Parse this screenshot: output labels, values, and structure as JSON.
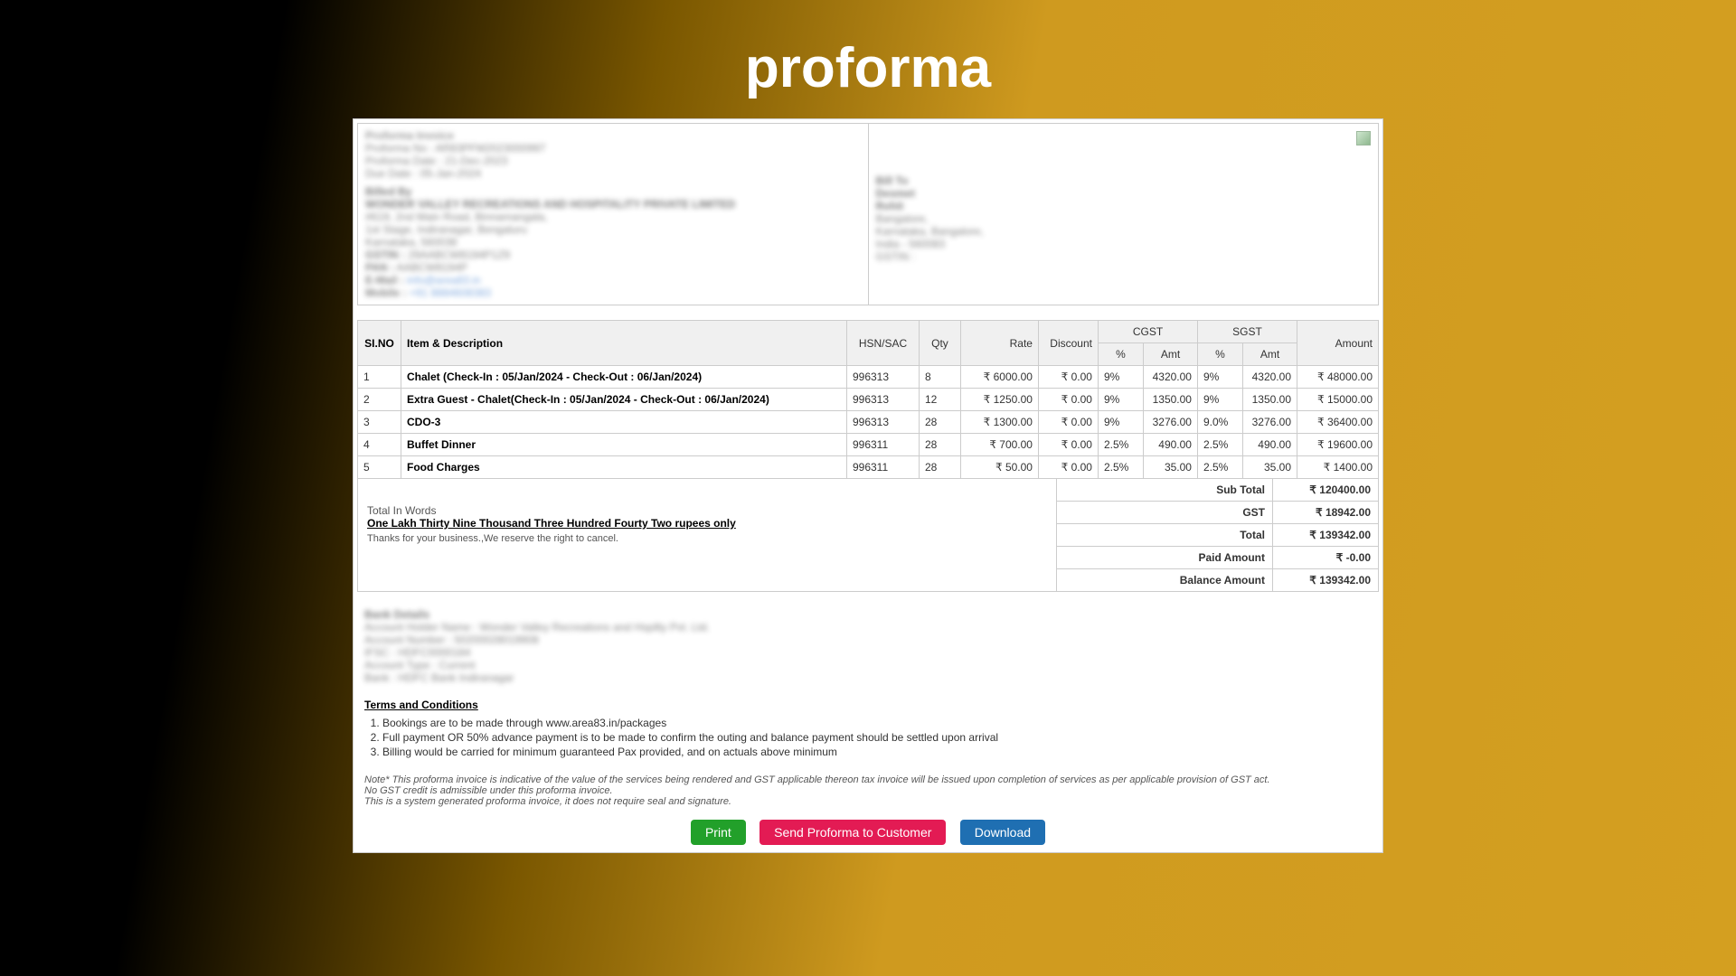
{
  "page_title": "proforma",
  "header": {
    "title": "Proforma Invoice",
    "proforma_no_label": "Proforma No :",
    "proforma_no": "AR83PFM2023000997",
    "proforma_date_label": "Proforma Date :",
    "proforma_date": "21-Dec-2023",
    "due_date_label": "Due Date :",
    "due_date": "05-Jan-2024"
  },
  "billed_by": {
    "label": "Billed By",
    "name": "WONDER VALLEY RECREATIONS AND HOSPITALITY PRIVATE LIMITED",
    "addr1": "#619, 2nd Main Road, Binnamangala,",
    "addr2": "1st Stage, Indiranagar, Bengaluru",
    "addr3": "Karnataka, 560038",
    "gstin_label": "GSTIN :",
    "gstin": "29AABCW8194P1Z9",
    "pan_label": "PAN :",
    "pan": "AABCW8194P",
    "email_label": "E-Mail :",
    "email": "info@area83.in",
    "mobile_label": "Mobile :",
    "mobile": "+91 8884608383"
  },
  "bill_to": {
    "label": "Bill To",
    "name1": "Desmet",
    "name2": "Rohit",
    "addr1": "Bangalore,",
    "addr2": "Karnataka, Bangalore,",
    "addr3": "India - 560083",
    "gstin": "GSTIN :"
  },
  "cols": {
    "slno": "SI.NO",
    "desc": "Item & Description",
    "hsn": "HSN/SAC",
    "qty": "Qty",
    "rate": "Rate",
    "discount": "Discount",
    "cgst": "CGST",
    "sgst": "SGST",
    "amount": "Amount",
    "pct": "%",
    "amt": "Amt"
  },
  "rows": [
    {
      "sl": "1",
      "desc": "Chalet (Check-In : 05/Jan/2024 - Check-Out : 06/Jan/2024)",
      "hsn": "996313",
      "qty": "8",
      "rate": "₹ 6000.00",
      "disc": "₹ 0.00",
      "cp": "9%",
      "ca": "4320.00",
      "sp": "9%",
      "sa": "4320.00",
      "amt": "₹ 48000.00"
    },
    {
      "sl": "2",
      "desc": "Extra Guest - Chalet(Check-In : 05/Jan/2024 - Check-Out : 06/Jan/2024)",
      "hsn": "996313",
      "qty": "12",
      "rate": "₹ 1250.00",
      "disc": "₹ 0.00",
      "cp": "9%",
      "ca": "1350.00",
      "sp": "9%",
      "sa": "1350.00",
      "amt": "₹ 15000.00"
    },
    {
      "sl": "3",
      "desc": "CDO-3",
      "hsn": "996313",
      "qty": "28",
      "rate": "₹ 1300.00",
      "disc": "₹ 0.00",
      "cp": "9%",
      "ca": "3276.00",
      "sp": "9.0%",
      "sa": "3276.00",
      "amt": "₹ 36400.00"
    },
    {
      "sl": "4",
      "desc": "Buffet Dinner",
      "hsn": "996311",
      "qty": "28",
      "rate": "₹ 700.00",
      "disc": "₹ 0.00",
      "cp": "2.5%",
      "ca": "490.00",
      "sp": "2.5%",
      "sa": "490.00",
      "amt": "₹ 19600.00"
    },
    {
      "sl": "5",
      "desc": "Food Charges",
      "hsn": "996311",
      "qty": "28",
      "rate": "₹ 50.00",
      "disc": "₹ 0.00",
      "cp": "2.5%",
      "ca": "35.00",
      "sp": "2.5%",
      "sa": "35.00",
      "amt": "₹ 1400.00"
    }
  ],
  "totals": {
    "sub_total_label": "Sub Total",
    "sub_total": "₹ 120400.00",
    "gst_label": "GST",
    "gst": "₹ 18942.00",
    "total_label": "Total",
    "total": "₹ 139342.00",
    "paid_label": "Paid Amount",
    "paid": "₹ -0.00",
    "balance_label": "Balance Amount",
    "balance": "₹ 139342.00"
  },
  "words": {
    "label": "Total In Words",
    "value": "One Lakh Thirty Nine Thousand Three Hundred Fourty Two rupees only",
    "thanks": "Thanks for your business.,We reserve the right to cancel."
  },
  "bank": {
    "heading": "Bank Details",
    "l1": "Account Holder Name : Wonder Valley Recreations and Hspilty Pvt. Ltd.",
    "l2": "Account Number : 50200028019908",
    "l3": "IFSC : HDFC0000184",
    "l4": "Account Type : Current",
    "l5": "Bank : HDFC Bank Indiranagar"
  },
  "terms_head": "Terms and Conditions",
  "terms": [
    "Bookings are to be made through www.area83.in/packages",
    "Full payment OR 50% advance payment is to be made to confirm the outing and balance payment should be settled upon arrival",
    "Billing would be carried for minimum guaranteed Pax provided, and on actuals above minimum"
  ],
  "note1": "Note* This proforma invoice is indicative of the value of the services being rendered and GST applicable thereon tax invoice will be issued upon completion of services as per applicable provision of GST act.",
  "note2": "No GST credit is admissible under this proforma invoice.",
  "note3": "This is a system generated proforma invoice, it does not require seal and signature.",
  "actions": {
    "print": "Print",
    "send": "Send Proforma to Customer",
    "download": "Download"
  }
}
